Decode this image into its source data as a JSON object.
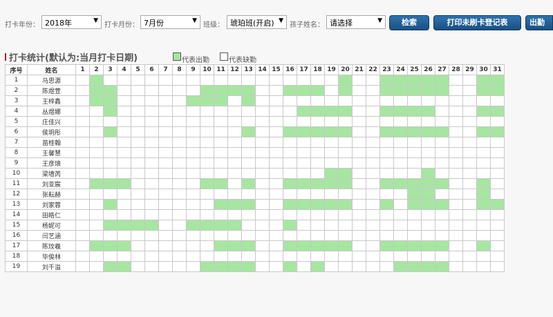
{
  "filters": {
    "year_label": "打卡年份：",
    "year_value": "2018年",
    "month_label": "打卡月份：",
    "month_value": "7月份",
    "class_label": "班级：",
    "class_value": "琥珀班(开启)",
    "child_label": "孩子姓名：",
    "child_value": "请选择",
    "dropdown_arrow": "▼"
  },
  "buttons": {
    "search": "检索",
    "print": "打印未刷卡登记表",
    "export": "出勤"
  },
  "section": {
    "title": "打卡统计(默认为:当月打卡日期)",
    "legend_present": "代表出勤",
    "legend_absent": "代表缺勤"
  },
  "colors": {
    "present": "#a6e6a1",
    "absent": "#ffffff",
    "button": "#1f5f99"
  },
  "table": {
    "col_index": "序号",
    "col_name": "姓名",
    "days": [
      "1",
      "2",
      "3",
      "4",
      "5",
      "6",
      "7",
      "8",
      "9",
      "10",
      "11",
      "12",
      "13",
      "14",
      "15",
      "16",
      "17",
      "18",
      "19",
      "20",
      "21",
      "22",
      "23",
      "24",
      "25",
      "26",
      "27",
      "28",
      "29",
      "30",
      "31"
    ],
    "rows": [
      {
        "idx": "1",
        "name": "马思源",
        "present": [
          2,
          20,
          23,
          24,
          25,
          26,
          27,
          30,
          31
        ]
      },
      {
        "idx": "2",
        "name": "陈煜萱",
        "present": [
          2,
          3,
          10,
          11,
          12,
          13,
          16,
          17,
          18,
          20,
          23,
          24,
          25,
          26,
          27,
          30,
          31
        ]
      },
      {
        "idx": "3",
        "name": "王梓鑫",
        "present": [
          2,
          3,
          9,
          10,
          11,
          13
        ]
      },
      {
        "idx": "4",
        "name": "丛煜娜",
        "present": [
          3,
          17,
          18,
          19,
          20,
          23,
          24,
          25,
          26,
          30,
          31
        ]
      },
      {
        "idx": "5",
        "name": "庄佳兴",
        "present": []
      },
      {
        "idx": "6",
        "name": "侯玥彤",
        "present": [
          3,
          13,
          16,
          17,
          18,
          19,
          20,
          23,
          24,
          25,
          26,
          27,
          30,
          31
        ]
      },
      {
        "idx": "7",
        "name": "苗桂翰",
        "present": []
      },
      {
        "idx": "8",
        "name": "王馨慧",
        "present": []
      },
      {
        "idx": "9",
        "name": "王彦琅",
        "present": []
      },
      {
        "idx": "10",
        "name": "梁墙芮",
        "present": [
          19,
          20,
          26
        ]
      },
      {
        "idx": "11",
        "name": "刘亚宸",
        "present": [
          2,
          3,
          4,
          10,
          11,
          13,
          16,
          17,
          18,
          19,
          20,
          23,
          24,
          25,
          26,
          27,
          30
        ]
      },
      {
        "idx": "12",
        "name": "张耘赫",
        "present": [
          25,
          26,
          30
        ]
      },
      {
        "idx": "13",
        "name": "刘家蓉",
        "present": [
          3,
          11,
          12,
          13,
          16,
          17,
          18,
          19,
          20,
          23,
          25,
          26,
          27,
          30,
          31
        ]
      },
      {
        "idx": "14",
        "name": "田皓仁",
        "present": []
      },
      {
        "idx": "15",
        "name": "杨妮可",
        "present": [
          3,
          4,
          5,
          6,
          9,
          10,
          11,
          12,
          16
        ]
      },
      {
        "idx": "16",
        "name": "闫艺涵",
        "present": []
      },
      {
        "idx": "17",
        "name": "陈玟羲",
        "present": [
          2,
          3,
          4,
          11,
          12,
          13,
          16,
          17,
          18,
          19,
          20,
          23,
          24,
          25,
          26,
          27,
          30
        ]
      },
      {
        "idx": "18",
        "name": "毕俊林",
        "present": []
      },
      {
        "idx": "19",
        "name": "刘千溢",
        "present": [
          3,
          4,
          10,
          11,
          12,
          13,
          16,
          18,
          24,
          25,
          26,
          27
        ]
      }
    ]
  }
}
